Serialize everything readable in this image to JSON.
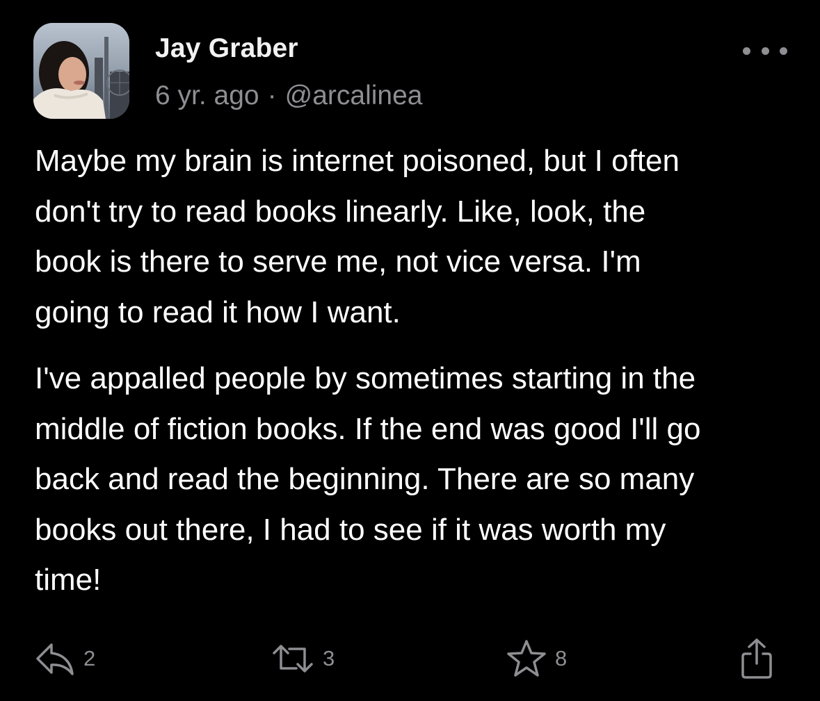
{
  "post": {
    "author": {
      "display_name": "Jay Graber",
      "handle": "@arcalinea",
      "avatar_icon": "profile-photo"
    },
    "timestamp": "6 yr. ago",
    "separator": "·",
    "more_icon": "ellipsis-horizontal-icon",
    "body": {
      "paragraph_1_lines": [
        "Maybe my brain is internet poisoned, but I often",
        "don't try to read books linearly. Like, look, the",
        "book is there to serve me, not vice versa. I'm",
        "going to read it how I want."
      ],
      "paragraph_2_lines": [
        "I've appalled people by sometimes starting in the",
        "middle of fiction books. If the end was good I'll go",
        "back and read the beginning. There are so many",
        "books out there, I had to see if it was worth my",
        "time!"
      ]
    },
    "actions": {
      "reply": {
        "icon": "reply-icon",
        "count": "2"
      },
      "repost": {
        "icon": "repost-icon",
        "count": "3"
      },
      "like": {
        "icon": "star-icon",
        "count": "8"
      },
      "share": {
        "icon": "share-icon"
      }
    }
  },
  "colors": {
    "background": "#000000",
    "primary_text": "#ffffff",
    "secondary_text": "#8e8e93"
  }
}
